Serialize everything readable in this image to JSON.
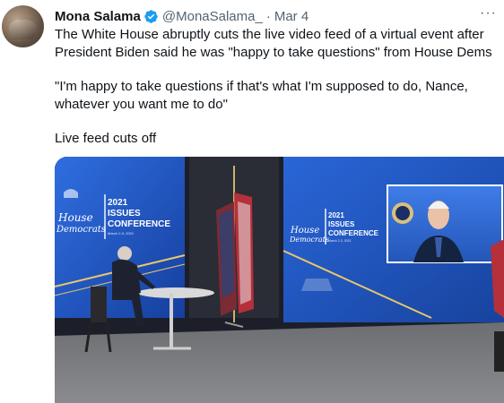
{
  "tweet": {
    "author_name": "Mona Salama",
    "handle": "@MonaSalama_",
    "separator": "·",
    "date": "Mar 4",
    "more_label": "···",
    "text_lines": [
      "The White House abruptly cuts the live video feed of a virtual event after President Biden said he was \"happy to take questions\" from House Dems",
      "\"I'm happy to take questions if that's what I'm supposed to do, Nance, whatever you want me to do\"",
      "Live feed cuts off"
    ]
  },
  "media": {
    "banner_left": {
      "line1": "2021",
      "line2": "ISSUES",
      "line3": "CONFERENCE",
      "sub": "March 2-3, 2021",
      "script_line1": "House",
      "script_line2": "Democrats"
    },
    "banner_right": {
      "line1": "2021",
      "line2": "ISSUES",
      "line3": "CONFERENCE",
      "sub": "March 2-3, 2021",
      "script_line1": "House",
      "script_line2": "Democrats"
    }
  },
  "colors": {
    "verified": "#1d9bf0",
    "handle_gray": "#536471",
    "screen_blue": "#1f56c9"
  }
}
